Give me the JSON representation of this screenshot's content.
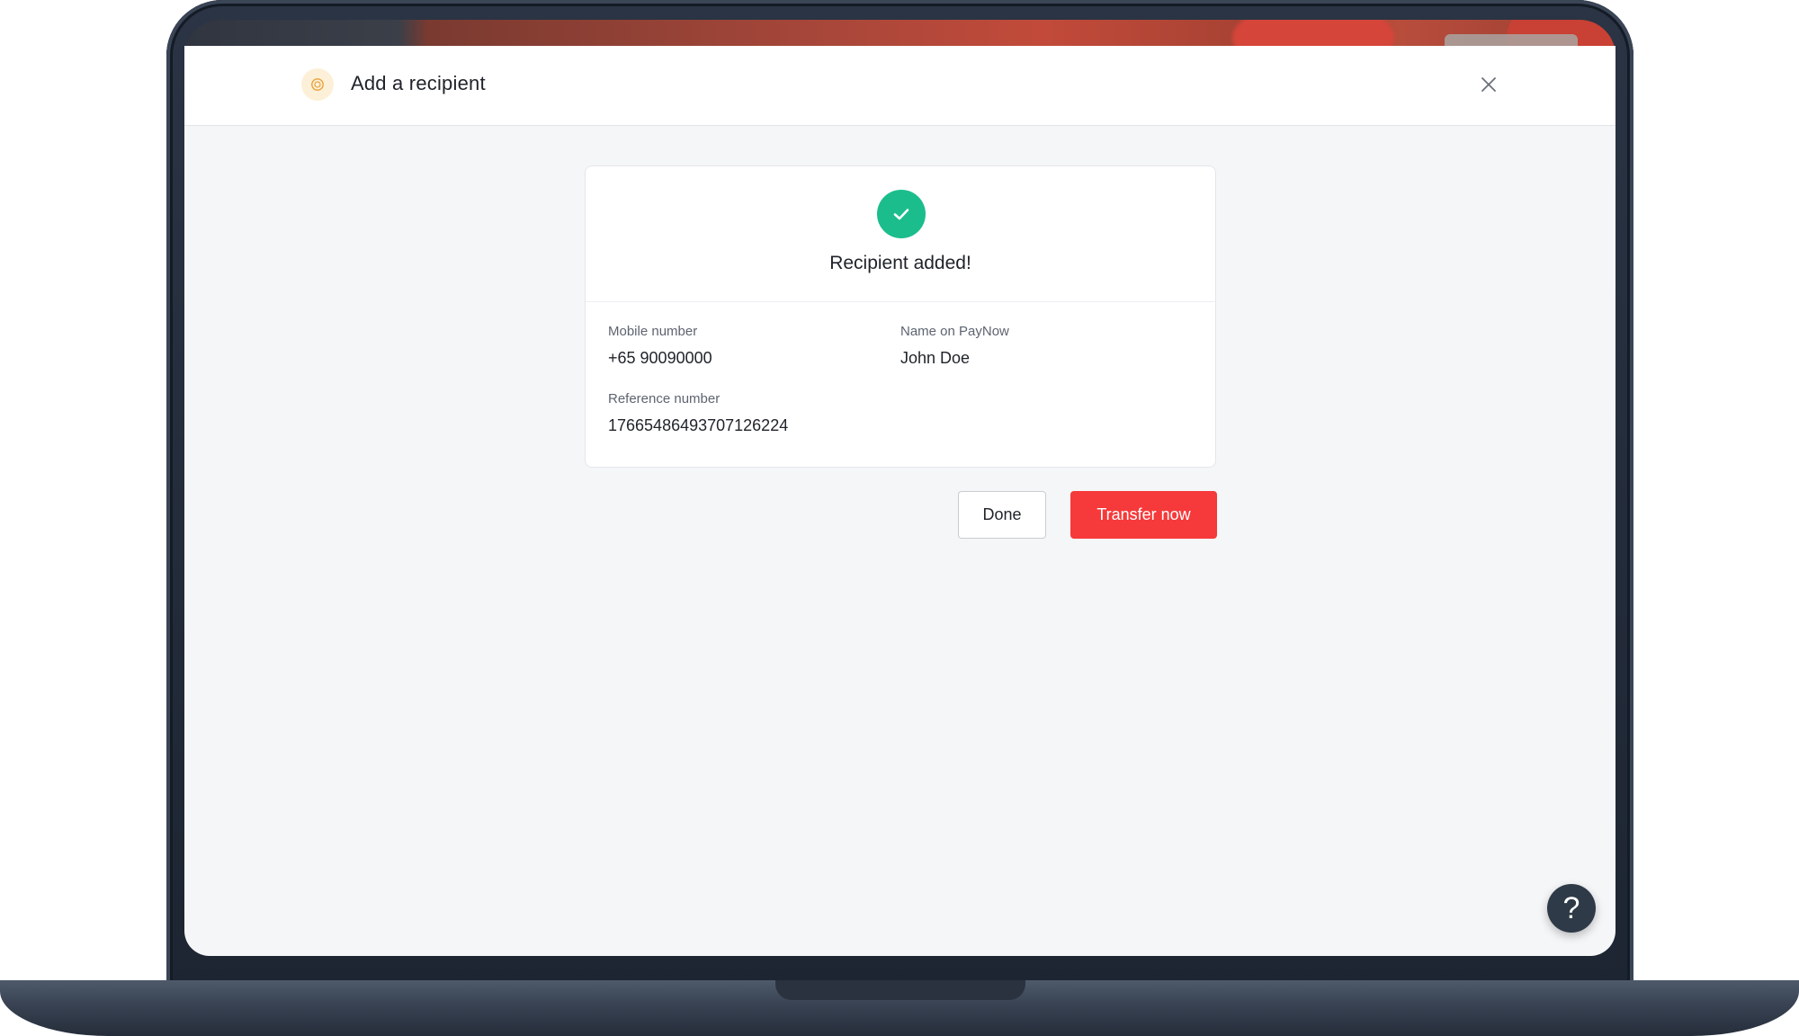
{
  "modal": {
    "title": "Add a recipient"
  },
  "result": {
    "title": "Recipient added!",
    "fields": {
      "mobile_label": "Mobile number",
      "mobile_value": "+65 90090000",
      "name_label": "Name on PayNow",
      "name_value": "John Doe",
      "reference_label": "Reference number",
      "reference_value": "17665486493707126224"
    }
  },
  "actions": {
    "done_label": "Done",
    "transfer_label": "Transfer now"
  },
  "help": {
    "label": "?"
  },
  "icons": {
    "header": "paynow-badge-icon",
    "close": "close-icon",
    "success": "check-icon",
    "help": "help-icon"
  },
  "colors": {
    "success": "#1bbd8c",
    "primary_action": "#f6393a",
    "header_badge": "#fdf0d8",
    "help_button": "#2e3a47"
  }
}
